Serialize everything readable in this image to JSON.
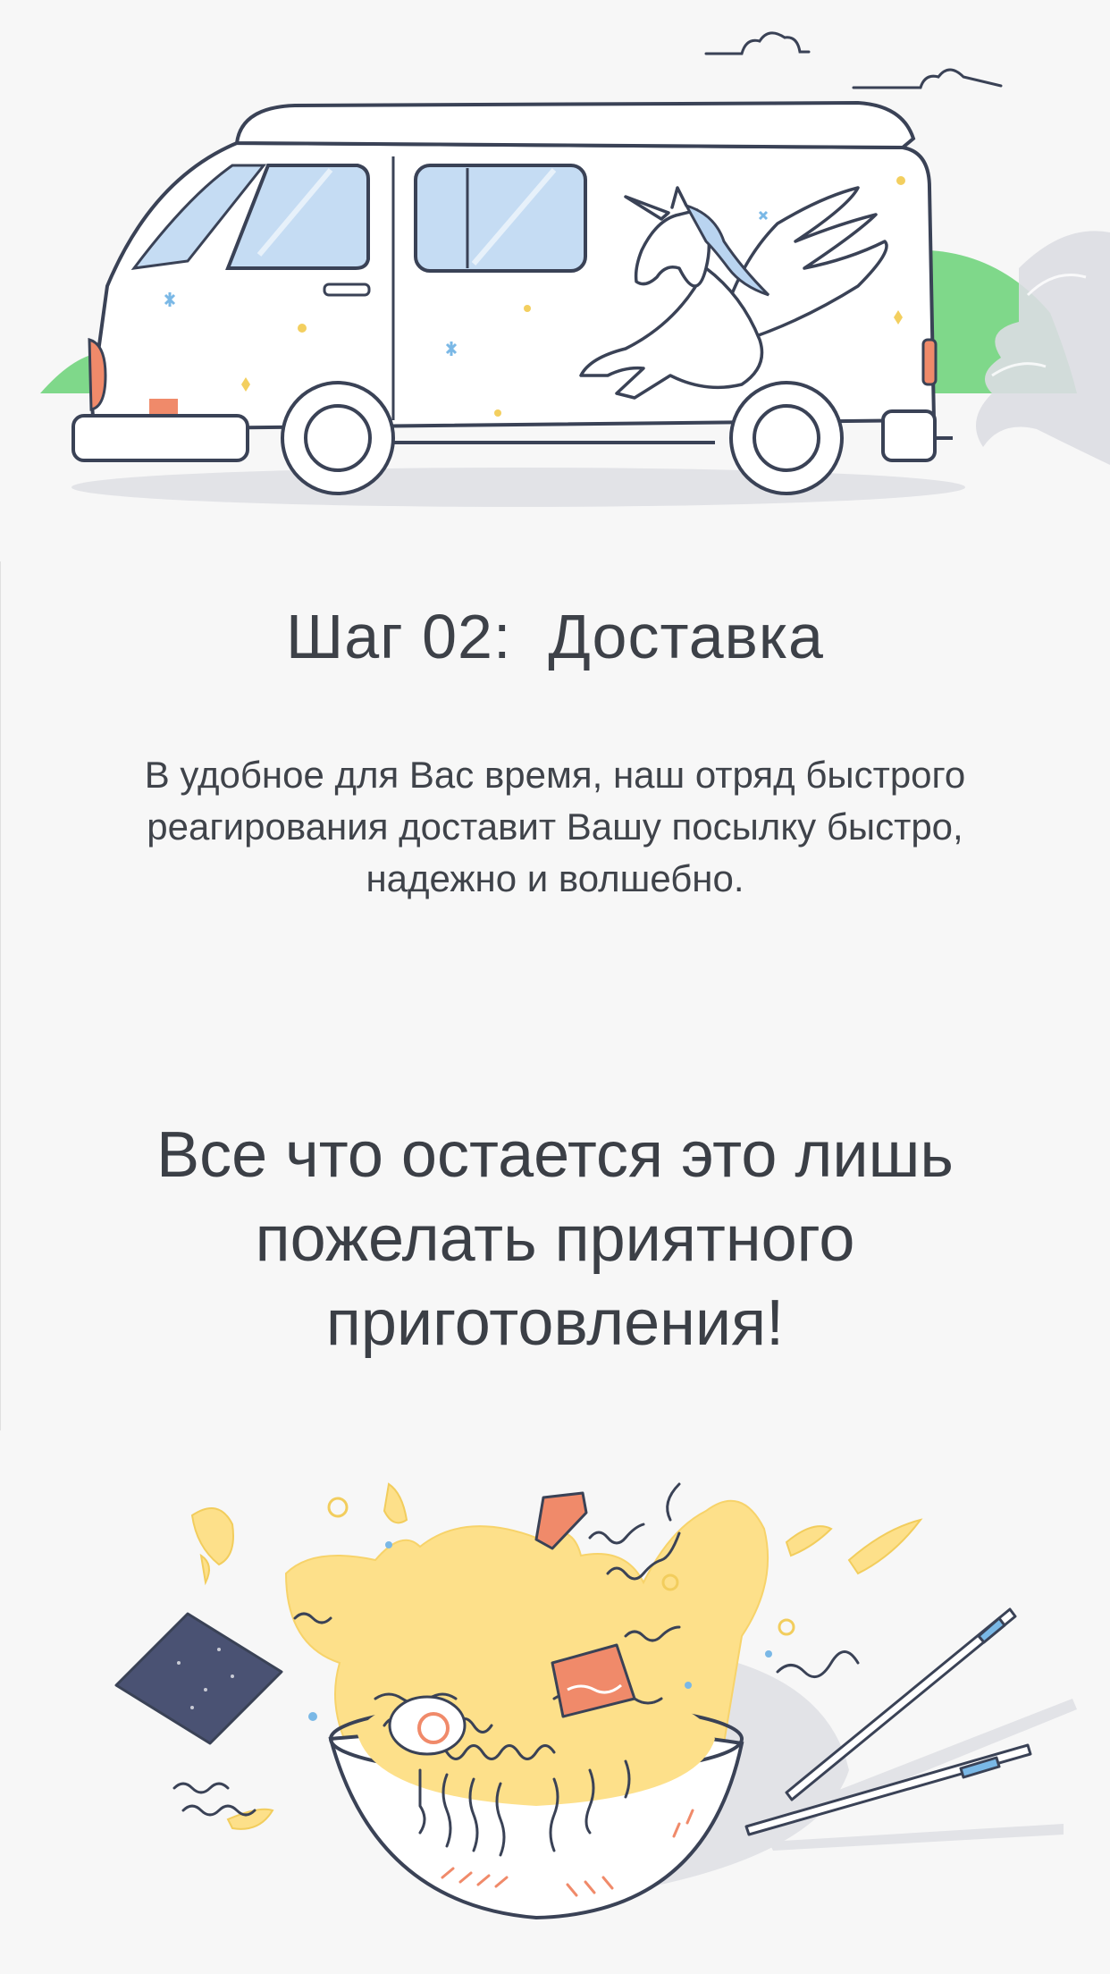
{
  "step": {
    "title": "Шаг 02:  Доставка",
    "description": "В удобное для Вас время, наш отряд быстрого реагирования доставит Вашу посылку быстро, надежно и волшебно."
  },
  "closing": {
    "message": "Все что остается это лишь пожелать приятного приготовления!"
  },
  "illustrations": {
    "top": "delivery-van-unicorn-illustration",
    "bottom": "noodle-bowl-illustration"
  },
  "colors": {
    "background": "#f7f7f7",
    "text": "#3d4148",
    "outline": "#3a4256",
    "window_blue": "#c5dcf3",
    "green": "#7fd88a",
    "accent_orange": "#f08a6a",
    "noodle_yellow": "#fde08a",
    "nori_navy": "#4a5273"
  }
}
